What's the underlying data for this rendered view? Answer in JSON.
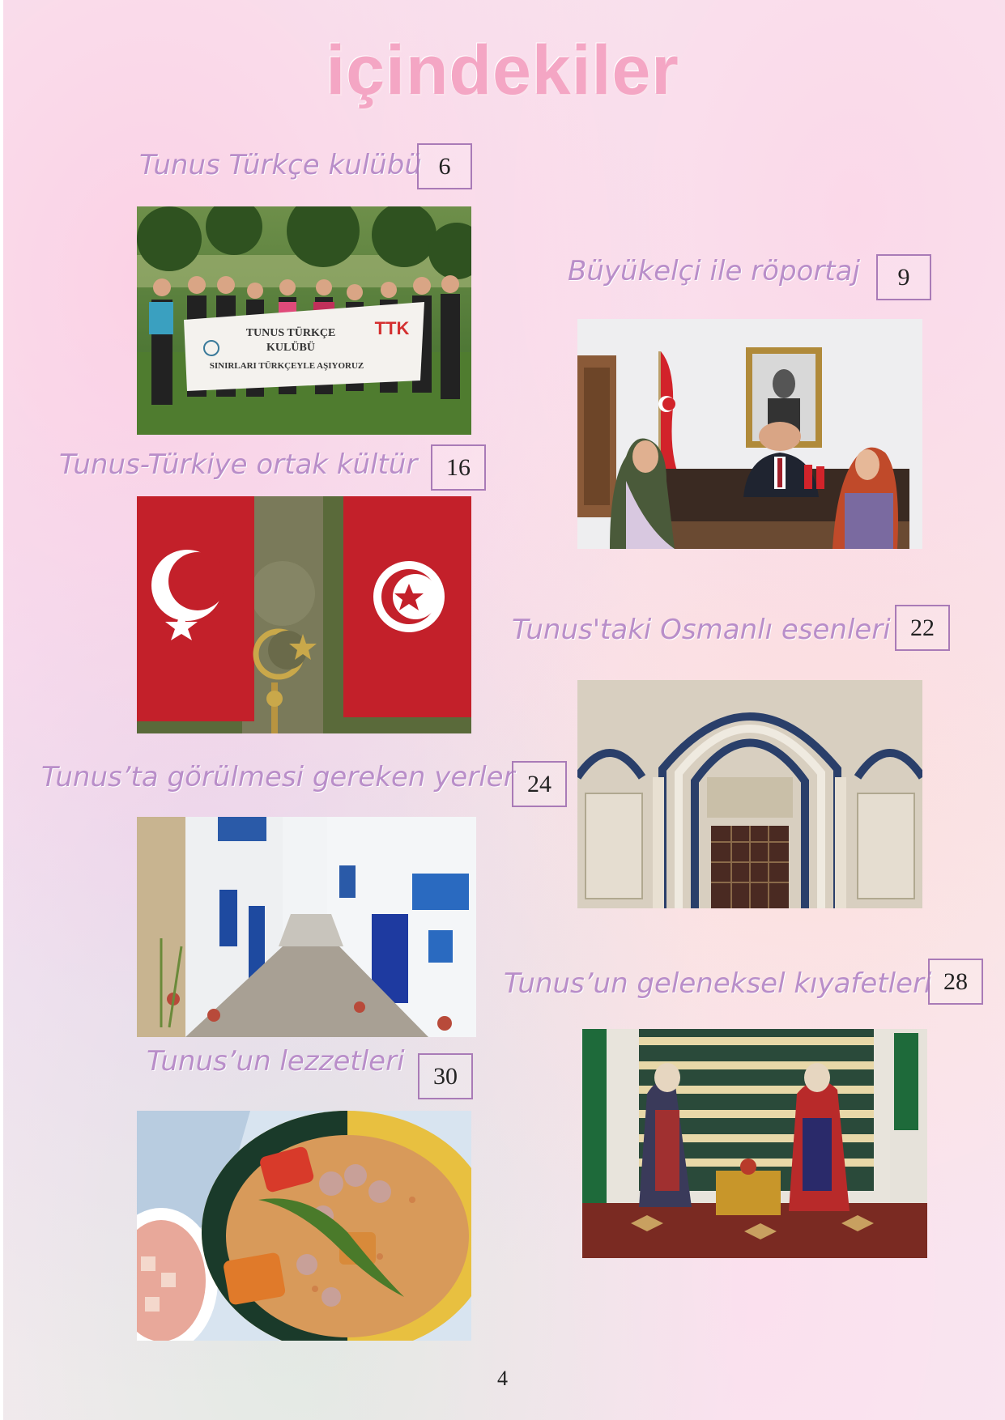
{
  "title": "içindekiler",
  "entries": [
    {
      "label": "Tunus Türkçe kulübü",
      "page": "6",
      "photo": "club-group-banner-photo"
    },
    {
      "label": "Büyükelçi ile röportaj",
      "page": "9",
      "photo": "ambassador-office-photo"
    },
    {
      "label": "Tunus-Türkiye ortak kültür",
      "page": "16",
      "photo": "flags-photo"
    },
    {
      "label": "Tunus'taki Osmanlı esenleri",
      "page": "22",
      "photo": "ottoman-doorway-photo"
    },
    {
      "label": "Tunus’ta görülmesi  gereken yerler",
      "page": "24",
      "photo": "blue-white-street-photo"
    },
    {
      "label": "Tunus’un geleneksel kıyafetleri",
      "page": "28",
      "photo": "traditional-costume-photo"
    },
    {
      "label": "Tunus’un lezzetleri",
      "page": "30",
      "photo": "couscous-dish-photo"
    }
  ],
  "banner": {
    "line1": "TUNUS TÜRKÇE",
    "line2": "KULÜBÜ",
    "line3": "SINIRLARI TÜRKÇEYLE AŞIYORUZ",
    "logo": "TTK"
  },
  "page_number": "4"
}
